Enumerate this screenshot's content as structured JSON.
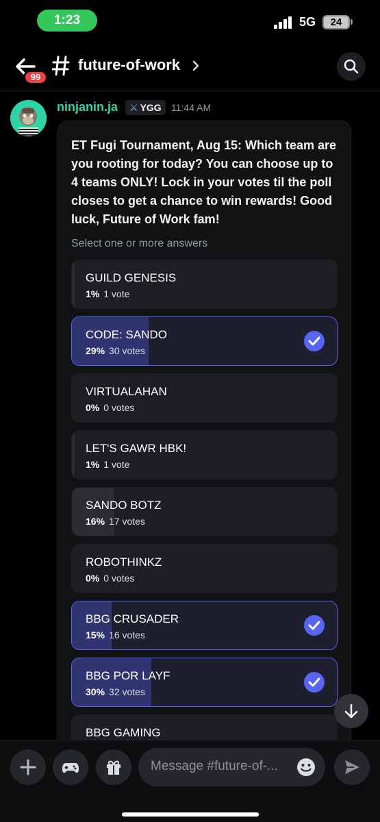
{
  "status": {
    "time": "1:23",
    "network": "5G",
    "battery": "24"
  },
  "header": {
    "unread_count": "99",
    "channel_name": "future-of-work"
  },
  "message": {
    "author": "ninjanin.ja",
    "tag": "YGG",
    "timestamp": "11:44 AM",
    "poll": {
      "question": "ET Fugi Tournament, Aug 15: Which team are you rooting for today? You can choose up to 4 teams ONLY! Lock in your votes til the poll closes to get a chance to win rewards! Good luck, Future of Work fam!",
      "hint": "Select one or more answers",
      "options": [
        {
          "label": "GUILD GENESIS",
          "percent": "1%",
          "votes": "1 vote",
          "fraction": 0.01,
          "selected": false
        },
        {
          "label": "CODE: SANDO",
          "percent": "29%",
          "votes": "30 votes",
          "fraction": 0.29,
          "selected": true
        },
        {
          "label": "VIRTUALAHAN",
          "percent": "0%",
          "votes": "0 votes",
          "fraction": 0.0,
          "selected": false
        },
        {
          "label": "LET'S GAWR HBK!",
          "percent": "1%",
          "votes": "1 vote",
          "fraction": 0.01,
          "selected": false
        },
        {
          "label": "SANDO BOTZ",
          "percent": "16%",
          "votes": "17 votes",
          "fraction": 0.16,
          "selected": false
        },
        {
          "label": "ROBOTHINKZ",
          "percent": "0%",
          "votes": "0 votes",
          "fraction": 0.0,
          "selected": false
        },
        {
          "label": "BBG CRUSADER",
          "percent": "15%",
          "votes": "16 votes",
          "fraction": 0.15,
          "selected": true
        },
        {
          "label": "BBG POR LAYF",
          "percent": "30%",
          "votes": "32 votes",
          "fraction": 0.3,
          "selected": true
        },
        {
          "label": "BBG GAMING",
          "percent": "",
          "votes": "",
          "fraction": 0.0,
          "selected": false
        }
      ]
    }
  },
  "composer": {
    "placeholder": "Message #future-of-..."
  },
  "colors": {
    "accent": "#5865f2",
    "online": "#34c759",
    "author": "#2dd4a8",
    "badge": "#f23f43"
  }
}
